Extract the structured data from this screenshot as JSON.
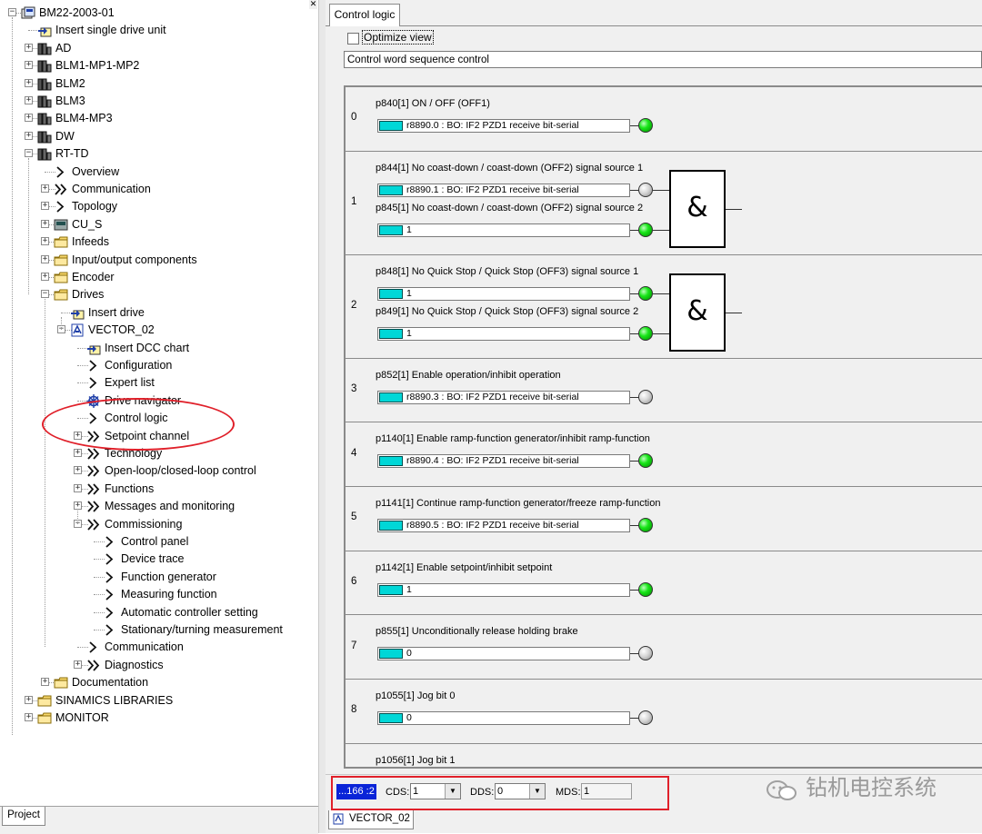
{
  "tree": {
    "project_root": "BM22-2003-01",
    "items": [
      {
        "label": "Insert single drive unit",
        "icon": "insert-icon"
      },
      {
        "label": "AD",
        "icon": "drive-unit-icon"
      },
      {
        "label": "BLM1-MP1-MP2",
        "icon": "drive-unit-icon"
      },
      {
        "label": "BLM2",
        "icon": "drive-unit-icon"
      },
      {
        "label": "BLM3",
        "icon": "drive-unit-icon"
      },
      {
        "label": "BLM4-MP3",
        "icon": "drive-unit-icon"
      },
      {
        "label": "DW",
        "icon": "drive-unit-icon"
      },
      {
        "label": "RT-TD",
        "icon": "drive-unit-icon"
      },
      {
        "label": "Overview",
        "icon": "chevron-right-icon"
      },
      {
        "label": "Communication",
        "icon": "double-chevron-icon"
      },
      {
        "label": "Topology",
        "icon": "chevron-right-icon"
      },
      {
        "label": "CU_S",
        "icon": "control-unit-icon"
      },
      {
        "label": "Infeeds",
        "icon": "folder-icon"
      },
      {
        "label": "Input/output components",
        "icon": "folder-icon"
      },
      {
        "label": "Encoder",
        "icon": "folder-icon"
      },
      {
        "label": "Drives",
        "icon": "folder-icon"
      },
      {
        "label": "Insert drive",
        "icon": "insert-icon"
      },
      {
        "label": "VECTOR_02",
        "icon": "drive-object-icon"
      },
      {
        "label": "Insert DCC chart",
        "icon": "insert-icon"
      },
      {
        "label": "Configuration",
        "icon": "chevron-right-icon"
      },
      {
        "label": "Expert list",
        "icon": "chevron-right-icon"
      },
      {
        "label": "Drive navigator",
        "icon": "navigator-icon"
      },
      {
        "label": "Control logic",
        "icon": "chevron-right-icon"
      },
      {
        "label": "Setpoint channel",
        "icon": "double-chevron-icon"
      },
      {
        "label": "Technology",
        "icon": "double-chevron-icon"
      },
      {
        "label": "Open-loop/closed-loop control",
        "icon": "double-chevron-icon"
      },
      {
        "label": "Functions",
        "icon": "double-chevron-icon"
      },
      {
        "label": "Messages and monitoring",
        "icon": "double-chevron-icon"
      },
      {
        "label": "Commissioning",
        "icon": "double-chevron-icon"
      },
      {
        "label": "Control panel",
        "icon": "chevron-right-icon"
      },
      {
        "label": "Device trace",
        "icon": "chevron-right-icon"
      },
      {
        "label": "Function generator",
        "icon": "chevron-right-icon"
      },
      {
        "label": "Measuring function",
        "icon": "chevron-right-icon"
      },
      {
        "label": "Automatic controller setting",
        "icon": "chevron-right-icon"
      },
      {
        "label": "Stationary/turning measurement",
        "icon": "chevron-right-icon"
      },
      {
        "label": "Communication",
        "icon": "chevron-right-icon"
      },
      {
        "label": "Diagnostics",
        "icon": "double-chevron-icon"
      },
      {
        "label": "Documentation",
        "icon": "folder-icon"
      },
      {
        "label": "SINAMICS LIBRARIES",
        "icon": "folder-icon"
      },
      {
        "label": "MONITOR",
        "icon": "folder-icon"
      }
    ],
    "project_tab": "Project"
  },
  "editor": {
    "tab_label": "Control logic",
    "optimize_view_label": "Optimize view",
    "sequence_field": "Control word sequence control",
    "rows": [
      {
        "index": "0",
        "signals": [
          {
            "label": "p840[1] ON / OFF (OFF1)",
            "value": "r8890.0 : BO: IF2 PZD1 receive bit-serial",
            "led": "on"
          }
        ]
      },
      {
        "index": "1",
        "signals": [
          {
            "label": "p844[1] No coast-down / coast-down (OFF2) signal source 1",
            "value": "r8890.1 : BO: IF2 PZD1 receive bit-serial",
            "led": "off"
          },
          {
            "label": "p845[1] No coast-down / coast-down (OFF2) signal source 2",
            "value": "1",
            "led": "on"
          }
        ],
        "gate": "&"
      },
      {
        "index": "2",
        "signals": [
          {
            "label": "p848[1] No Quick Stop / Quick Stop (OFF3) signal source 1",
            "value": "1",
            "led": "on"
          },
          {
            "label": "p849[1] No Quick Stop / Quick Stop (OFF3) signal source 2",
            "value": "1",
            "led": "on"
          }
        ],
        "gate": "&"
      },
      {
        "index": "3",
        "signals": [
          {
            "label": "p852[1] Enable operation/inhibit operation",
            "value": "r8890.3 : BO: IF2 PZD1 receive bit-serial",
            "led": "off"
          }
        ]
      },
      {
        "index": "4",
        "signals": [
          {
            "label": "p1140[1] Enable ramp-function generator/inhibit ramp-function",
            "value": "r8890.4 : BO: IF2 PZD1 receive bit-serial",
            "led": "on"
          }
        ]
      },
      {
        "index": "5",
        "signals": [
          {
            "label": "p1141[1] Continue ramp-function generator/freeze ramp-function",
            "value": "r8890.5 : BO: IF2 PZD1 receive bit-serial",
            "led": "on"
          }
        ]
      },
      {
        "index": "6",
        "signals": [
          {
            "label": "p1142[1] Enable setpoint/inhibit setpoint",
            "value": "1",
            "led": "on"
          }
        ]
      },
      {
        "index": "7",
        "signals": [
          {
            "label": "p855[1] Unconditionally release holding brake",
            "value": "0",
            "led": "off"
          }
        ]
      },
      {
        "index": "8",
        "signals": [
          {
            "label": "p1055[1] Jog bit 0",
            "value": "0",
            "led": "off"
          }
        ]
      },
      {
        "index": "",
        "signals": [
          {
            "label": "p1056[1] Jog bit 1",
            "value": "",
            "led": "off"
          }
        ]
      }
    ]
  },
  "status_bar": {
    "address": "...166 :2",
    "cds_label": "CDS:",
    "cds_value": "1",
    "dds_label": "DDS:",
    "dds_value": "0",
    "mds_label": "MDS:",
    "mds_value": "1"
  },
  "bottom_tab": "VECTOR_02",
  "watermark": "钻机电控系统",
  "colors": {
    "highlight": "#e0202a",
    "led_on": "#19e619",
    "led_off": "#d6d6d6",
    "signal_button": "#00d7d7",
    "address_bg": "#0a24d8"
  }
}
